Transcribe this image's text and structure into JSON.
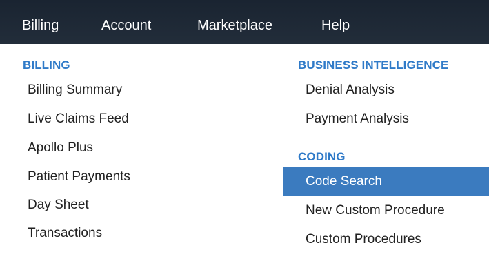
{
  "topnav": {
    "items": [
      {
        "label": "Billing"
      },
      {
        "label": "Account"
      },
      {
        "label": "Marketplace"
      },
      {
        "label": "Help"
      }
    ]
  },
  "dropdown": {
    "billing": {
      "heading": "BILLING",
      "items": [
        {
          "label": "Billing Summary"
        },
        {
          "label": "Live Claims Feed"
        },
        {
          "label": "Apollo Plus"
        },
        {
          "label": "Patient Payments"
        },
        {
          "label": "Day Sheet"
        },
        {
          "label": "Transactions"
        }
      ]
    },
    "business_intelligence": {
      "heading": "BUSINESS INTELLIGENCE",
      "items": [
        {
          "label": "Denial Analysis"
        },
        {
          "label": "Payment Analysis"
        }
      ]
    },
    "coding": {
      "heading": "CODING",
      "items": [
        {
          "label": "Code Search",
          "active": true
        },
        {
          "label": "New Custom Procedure"
        },
        {
          "label": "Custom Procedures"
        }
      ]
    }
  },
  "colors": {
    "navbar_bg": "#1f2a37",
    "heading": "#2f7ac8",
    "active_bg": "#3b7bbf",
    "text": "#222222"
  }
}
